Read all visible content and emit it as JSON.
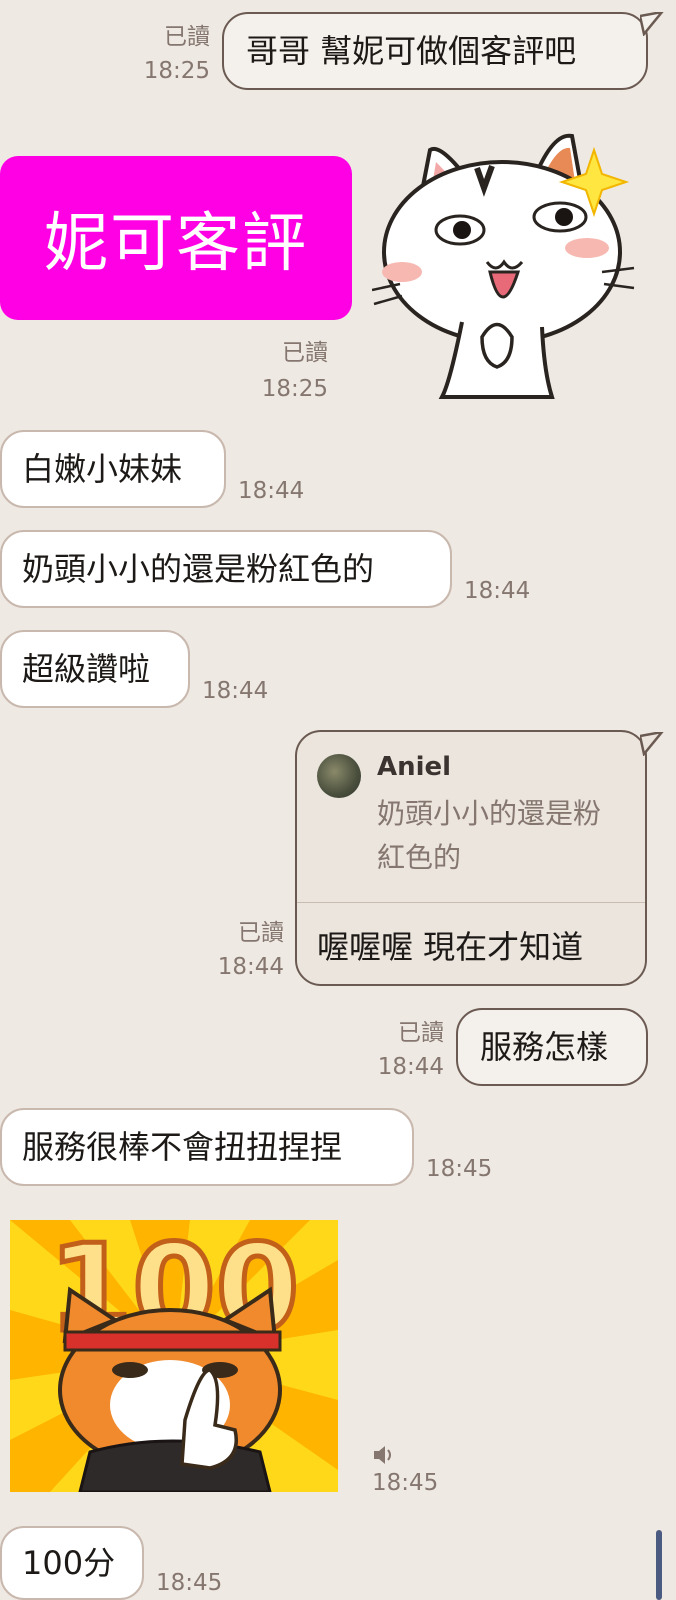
{
  "read_label": "已讀",
  "messages": {
    "m1": {
      "text": "哥哥 幫妮可做個客評吧",
      "time": "18:25"
    },
    "m2": {
      "text": "妮可客評",
      "time": "18:25"
    },
    "m3": {
      "text": "白嫩小妹妹",
      "time": "18:44"
    },
    "m4": {
      "text": "奶頭小小的還是粉紅色的",
      "time": "18:44"
    },
    "m5": {
      "text": "超級讚啦",
      "time": "18:44"
    },
    "m6": {
      "quote_name": "Aniel",
      "quote_text": "奶頭小小的還是粉紅色的",
      "text": "喔喔喔 現在才知道",
      "time": "18:44"
    },
    "m7": {
      "text": "服務怎樣",
      "time": "18:44"
    },
    "m8": {
      "text": "服務很棒不會扭扭捏捏",
      "time": "18:45"
    },
    "m9": {
      "sticker_number": "100",
      "time": "18:45"
    },
    "m10": {
      "text": "100分",
      "time": "18:45"
    }
  },
  "colors": {
    "background": "#efe9e3",
    "outgoing_border": "#6a5a52",
    "magenta": "#ff00e4",
    "scrollbar": "#4a5a80"
  },
  "icons": {
    "sound": "speaker-icon"
  }
}
